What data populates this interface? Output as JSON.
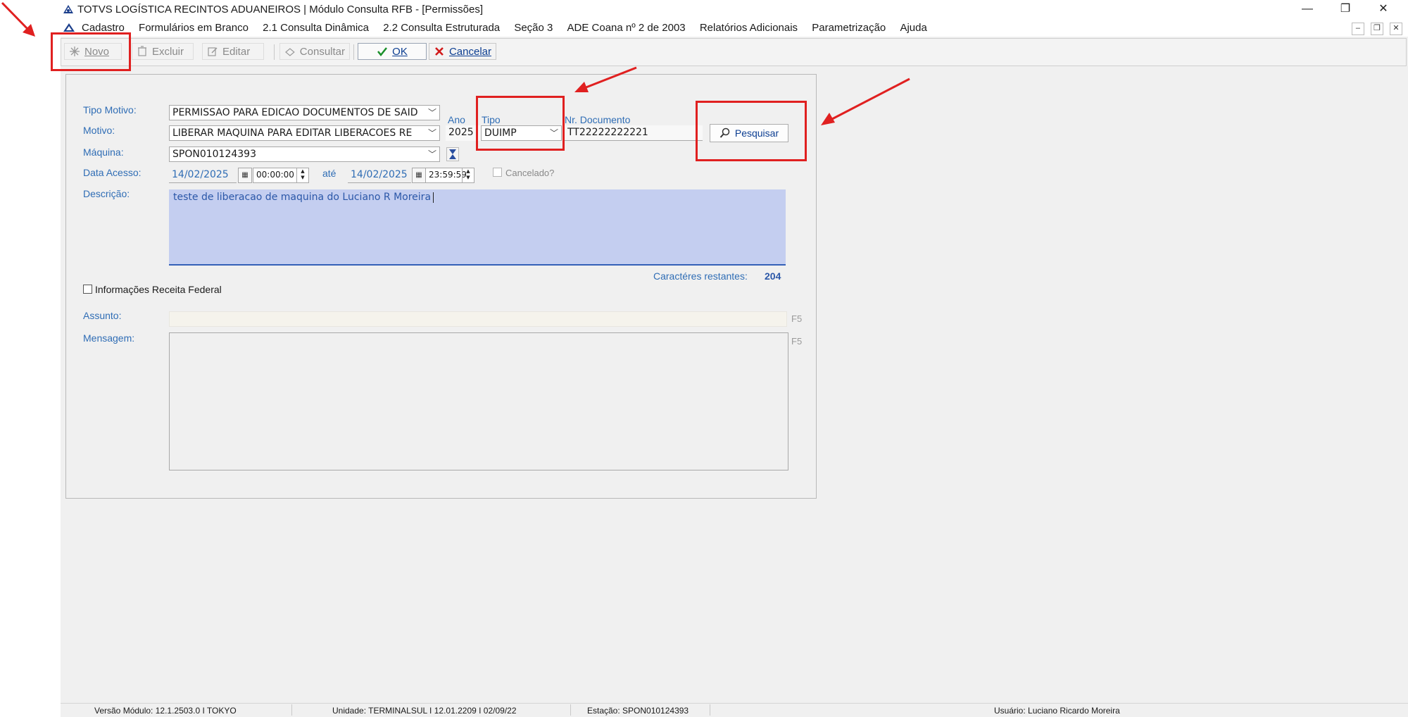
{
  "window": {
    "title": "TOTVS LOGÍSTICA RECINTOS ADUANEIROS | Módulo Consulta RFB - [Permissões]",
    "controls": {
      "minimize": "—",
      "restore": "❐",
      "close": "✕"
    }
  },
  "menu": {
    "items": [
      "Cadastro",
      "Formulários em Branco",
      "2.1 Consulta Dinâmica",
      "2.2 Consulta Estruturada",
      "Seção 3",
      "ADE Coana nº 2 de 2003",
      "Relatórios Adicionais",
      "Parametrização",
      "Ajuda"
    ],
    "mdi": {
      "minimize": "–",
      "restore": "❐",
      "close": "✕"
    }
  },
  "toolbar": {
    "novo": "Novo",
    "excluir": "Excluir",
    "editar": "Editar",
    "consultar": "Consultar",
    "ok": "OK",
    "cancelar": "Cancelar"
  },
  "form": {
    "tipo_motivo_label": "Tipo Motivo:",
    "tipo_motivo_value": "PERMISSAO PARA EDICAO DOCUMENTOS DE SAID",
    "motivo_label": "Motivo:",
    "motivo_value": "LIBERAR MAQUINA PARA EDITAR LIBERACOES RE",
    "ano_label": "Ano",
    "ano_value": "2025",
    "tipo_label": "Tipo",
    "tipo_value": "DUIMP",
    "nr_documento_label": "Nr. Documento",
    "nr_documento_value": "TT22222222221",
    "pesquisar_label": "Pesquisar",
    "maquina_label": "Máquina:",
    "maquina_value": "SPON010124393",
    "data_acesso_label": "Data Acesso:",
    "data_inicio": "14/02/2025",
    "hora_inicio": "00:00:00",
    "ate_label": "até",
    "data_fim": "14/02/2025",
    "hora_fim": "23:59:59",
    "cancelado_label": "Cancelado?",
    "descricao_label": "Descrição:",
    "descricao_value": "teste de liberacao de maquina do Luciano R Moreira",
    "caracteres_label": "Caractéres restantes:",
    "caracteres_value": "204",
    "info_receita_label": "Informações Receita Federal",
    "assunto_label": "Assunto:",
    "mensagem_label": "Mensagem:",
    "f5_label": "F5"
  },
  "status": {
    "versao": "Versão Módulo:  12.1.2503.0  I  TOKYO",
    "unidade": "Unidade: TERMINALSUL I 12.01.2209 I 02/09/22",
    "estacao": "Estação: SPON010124393",
    "usuario": "Usuário: Luciano Ricardo Moreira"
  },
  "colors": {
    "accent": "#2f6db5",
    "annotation": "#e02020",
    "selection": "#c4cef0"
  }
}
